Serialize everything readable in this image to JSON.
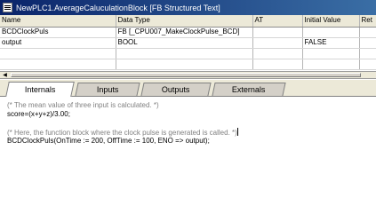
{
  "window": {
    "title": "NewPLC1.AverageCaluculationBlock [FB Structured Text]"
  },
  "variables": {
    "columns": [
      "Name",
      "Data Type",
      "AT",
      "Initial Value",
      "Ret"
    ],
    "rows": [
      {
        "name": "BCDClockPuls",
        "type": "FB [_CPU007_MakeClockPulse_BCD]",
        "at": "",
        "initial": ""
      },
      {
        "name": "output",
        "type": "BOOL",
        "at": "",
        "initial": "FALSE"
      }
    ]
  },
  "tabs": [
    "Internals",
    "Inputs",
    "Outputs",
    "Externals"
  ],
  "code": {
    "lines": [
      {
        "text": "(* The mean value of three input is calculated. *)",
        "kind": "comment"
      },
      {
        "text": "score=(x+y+z)/3.00;",
        "kind": "code"
      },
      {
        "text": "",
        "kind": "code"
      },
      {
        "text": "(* Here, the function block where the clock pulse is generated is called. *)",
        "kind": "comment"
      },
      {
        "text": "BCDClockPuls(OnTime := 200, OffTime := 100, ENO => output);",
        "kind": "code"
      }
    ]
  }
}
